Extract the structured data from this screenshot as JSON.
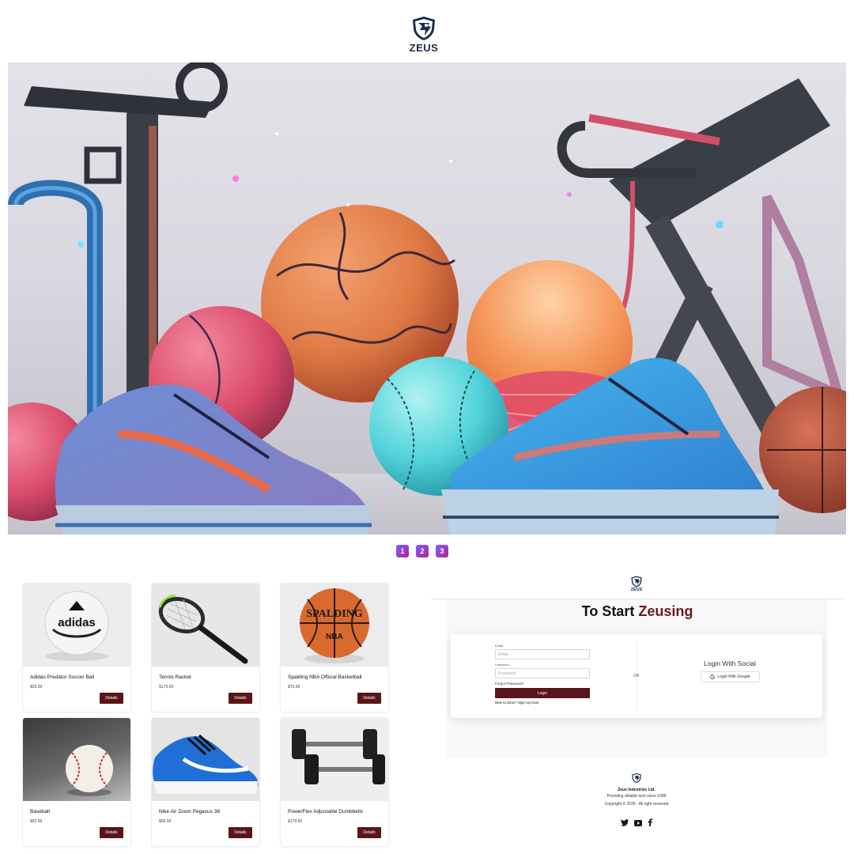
{
  "brand": {
    "name": "ZEUS"
  },
  "carousel": {
    "pages": [
      "1",
      "2",
      "3"
    ]
  },
  "products": [
    {
      "name": "Adidas Predator Soccer Ball",
      "price": "$29.99",
      "button": "Details",
      "icon": "soccer-ball"
    },
    {
      "name": "Tennis Racket",
      "price": "$179.99",
      "button": "Details",
      "icon": "tennis-racket"
    },
    {
      "name": "Spalding NBA Official Basketball",
      "price": "$79.99",
      "button": "Details",
      "icon": "basketball"
    },
    {
      "name": "Baseball",
      "price": "$52.99",
      "button": "Details",
      "icon": "baseball"
    },
    {
      "name": "Nike Air Zoom Pegasus 38",
      "price": "$99.99",
      "button": "Details",
      "icon": "running-shoe"
    },
    {
      "name": "PowerFlex Adjustable Dumbbells",
      "price": "$179.99",
      "button": "Details",
      "icon": "dumbbells"
    }
  ],
  "login": {
    "title_prefix": "To Start ",
    "title_accent": "Zeusing",
    "email_label": "Email",
    "email_placeholder": "Email",
    "password_label": "Password",
    "password_placeholder": "Password",
    "forgot": "Forgot Password?",
    "login_button": "Login",
    "signup": "New to Zeus? Sign Up Now",
    "or": "OR",
    "social_title": "Login With Social",
    "google_button": "Login With Google"
  },
  "footer": {
    "company": "Zeus Industries Ltd.",
    "tagline": "Providing reliable tech since 1999",
    "copyright": "Copyright © 2025 - All right reserved",
    "social_icons": [
      "twitter-icon",
      "youtube-icon",
      "facebook-icon"
    ]
  },
  "colors": {
    "accent": "#5a1519",
    "title_accent": "#6a1b1f",
    "carousel_start": "#7b5cff",
    "carousel_end": "#c2185b"
  }
}
